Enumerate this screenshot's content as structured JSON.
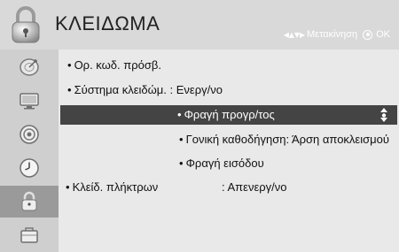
{
  "header": {
    "title": "ΚΛΕΙΔΩΜΑ",
    "hint_move": "Μετακίνηση",
    "hint_ok": "OK"
  },
  "sidebar": {
    "items": [
      {
        "icon": "satellite-dish-icon"
      },
      {
        "icon": "monitor-icon"
      },
      {
        "icon": "speaker-icon"
      },
      {
        "icon": "clock-icon"
      },
      {
        "icon": "padlock-icon",
        "active": true
      },
      {
        "icon": "briefcase-icon"
      }
    ]
  },
  "menu": {
    "password": "Ορ. κωδ. πρόσβ.",
    "lock_system": "Σύστημα κλειδώμ. : Ενεργ/νο",
    "block_program": "Φραγή προγρ/τος",
    "parental": "Γονική καθοδήγηση: Άρση αποκλεισμού",
    "input_block": "Φραγή εισόδου",
    "key_lock_label": "Κλείδ. πλήκτρων",
    "key_lock_value": ": Απενεργ/νο"
  },
  "colors": {
    "selected_row": "#444444",
    "active_sidebar": "#9a9a9a"
  }
}
